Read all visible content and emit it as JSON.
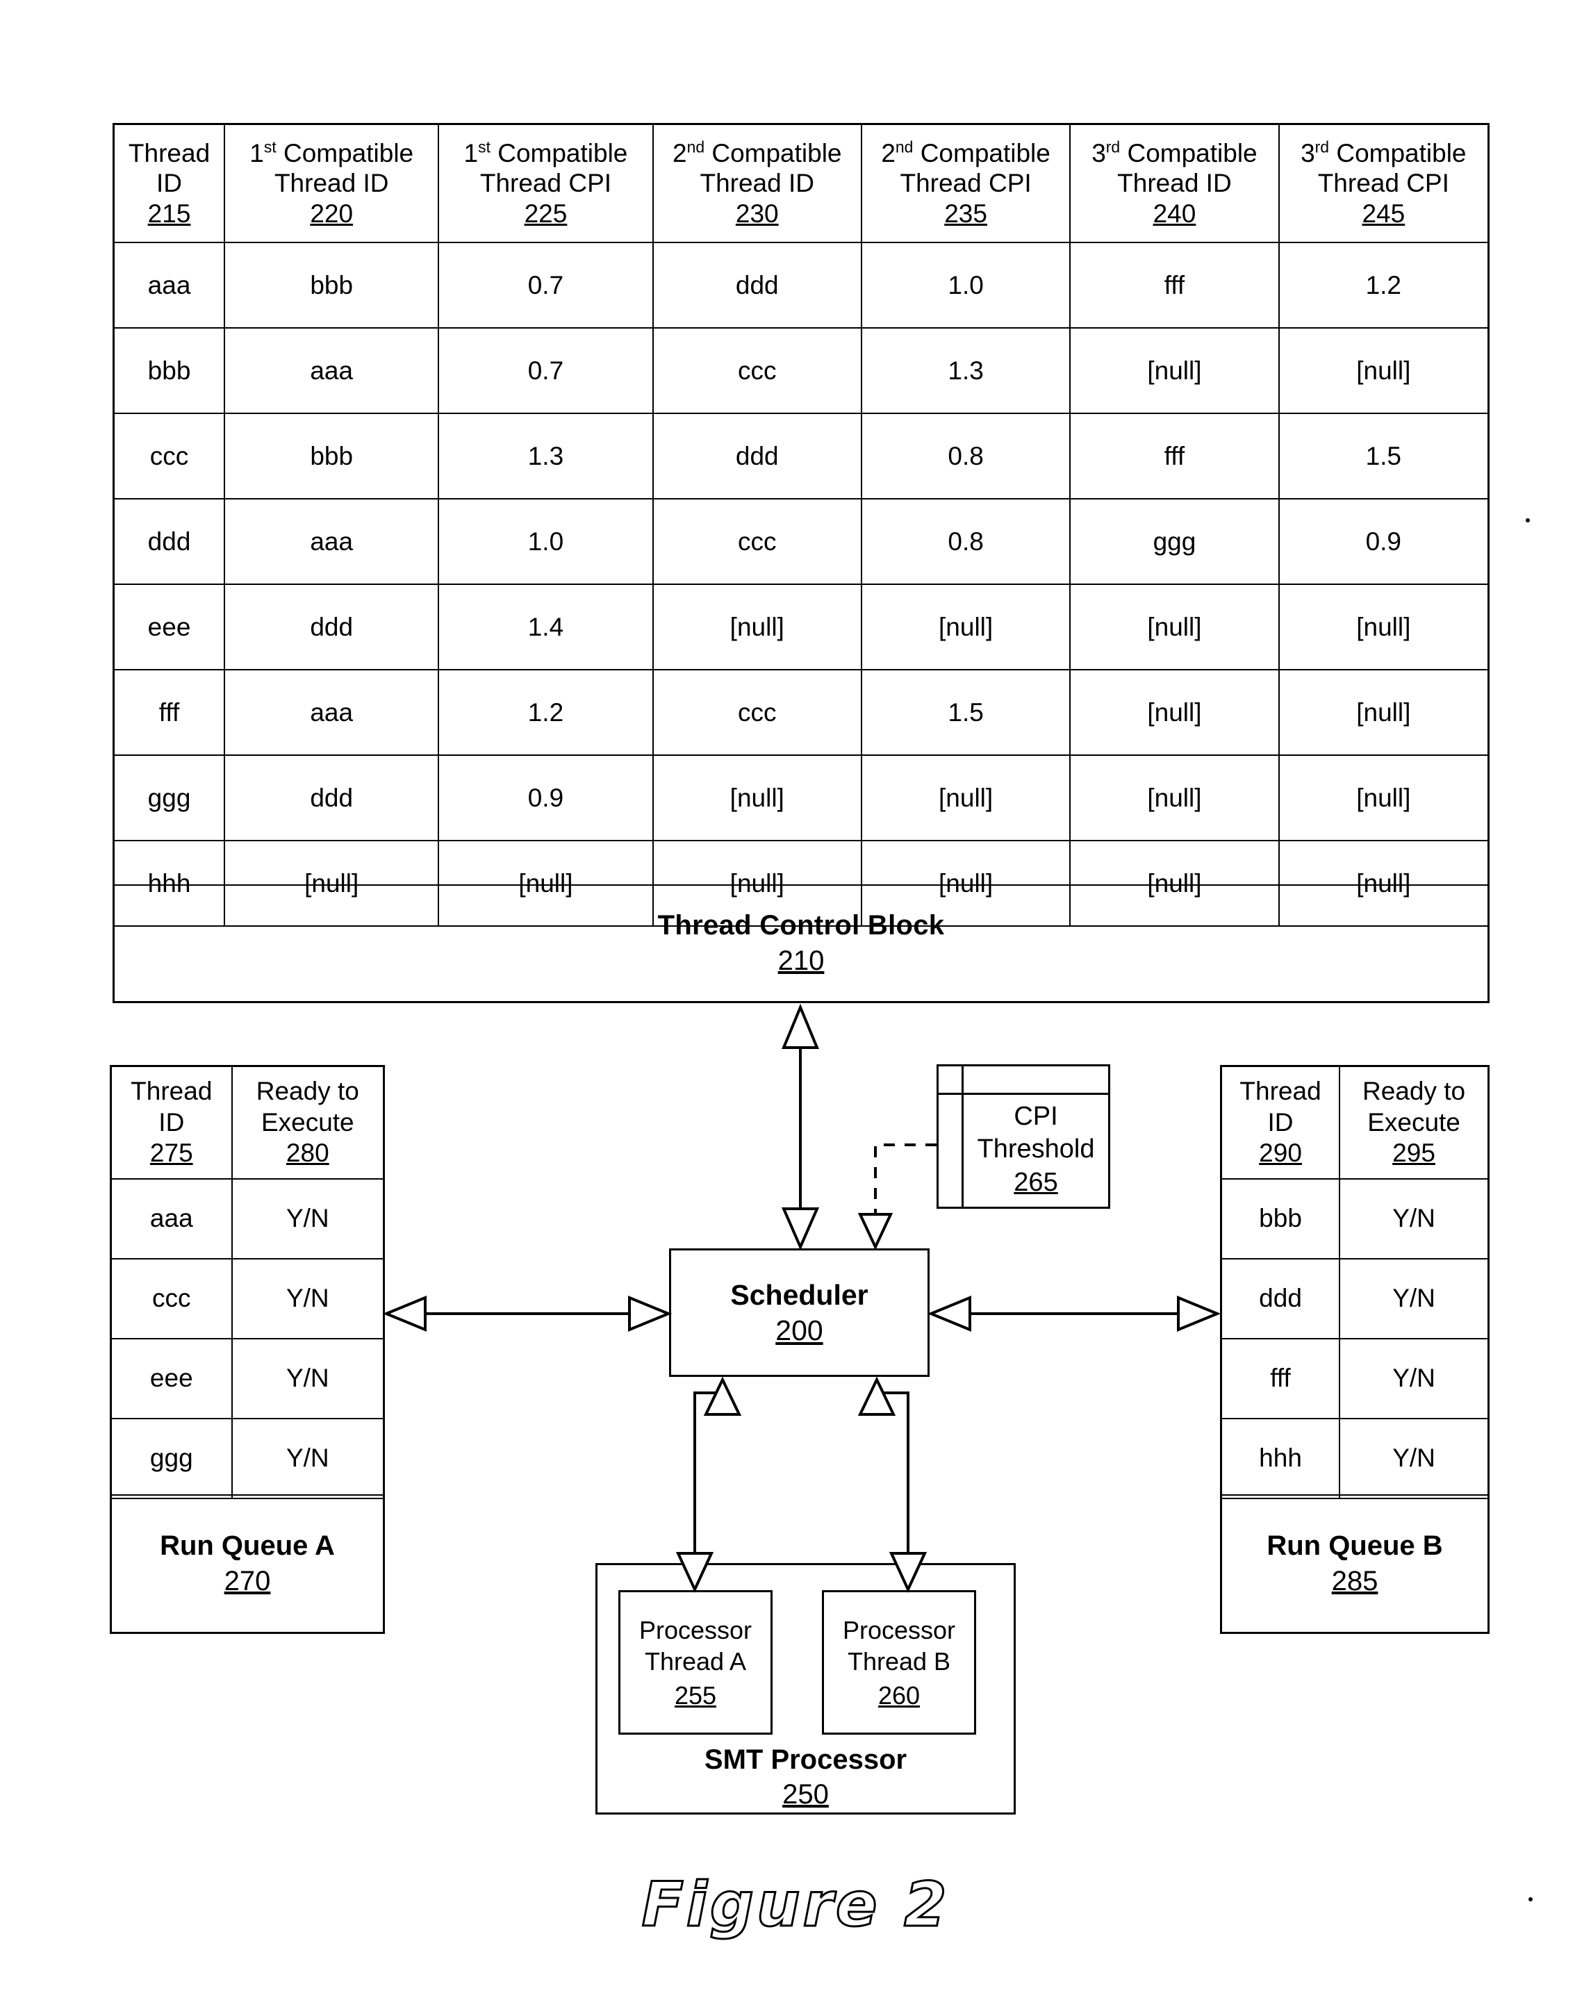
{
  "figure": {
    "caption": "Figure 2"
  },
  "thread_control_block": {
    "title": "Thread Control Block",
    "ref": "210",
    "columns": [
      {
        "line1": "Thread",
        "line2": "ID",
        "ref": "215",
        "sup": ""
      },
      {
        "line1": "1",
        "sup": "st",
        "line1_rest": " Compatible",
        "line2": "Thread ID",
        "ref": "220"
      },
      {
        "line1": "1",
        "sup": "st",
        "line1_rest": " Compatible",
        "line2": "Thread CPI",
        "ref": "225"
      },
      {
        "line1": "2",
        "sup": "nd",
        "line1_rest": " Compatible",
        "line2": "Thread ID",
        "ref": "230"
      },
      {
        "line1": "2",
        "sup": "nd",
        "line1_rest": " Compatible",
        "line2": "Thread CPI",
        "ref": "235"
      },
      {
        "line1": "3",
        "sup": "rd",
        "line1_rest": " Compatible",
        "line2": "Thread ID",
        "ref": "240"
      },
      {
        "line1": "3",
        "sup": "rd",
        "line1_rest": " Compatible",
        "line2": "Thread CPI",
        "ref": "245"
      }
    ],
    "rows": [
      [
        "aaa",
        "bbb",
        "0.7",
        "ddd",
        "1.0",
        "fff",
        "1.2"
      ],
      [
        "bbb",
        "aaa",
        "0.7",
        "ccc",
        "1.3",
        "[null]",
        "[null]"
      ],
      [
        "ccc",
        "bbb",
        "1.3",
        "ddd",
        "0.8",
        "fff",
        "1.5"
      ],
      [
        "ddd",
        "aaa",
        "1.0",
        "ccc",
        "0.8",
        "ggg",
        "0.9"
      ],
      [
        "eee",
        "ddd",
        "1.4",
        "[null]",
        "[null]",
        "[null]",
        "[null]"
      ],
      [
        "fff",
        "aaa",
        "1.2",
        "ccc",
        "1.5",
        "[null]",
        "[null]"
      ],
      [
        "ggg",
        "ddd",
        "0.9",
        "[null]",
        "[null]",
        "[null]",
        "[null]"
      ],
      [
        "hhh",
        "[null]",
        "[null]",
        "[null]",
        "[null]",
        "[null]",
        "[null]"
      ]
    ]
  },
  "run_queue_a": {
    "title": "Run Queue A",
    "ref": "270",
    "columns": [
      {
        "line1": "Thread",
        "line2": "ID",
        "ref": "275"
      },
      {
        "line1": "Ready to",
        "line2": "Execute",
        "ref": "280"
      }
    ],
    "rows": [
      [
        "aaa",
        "Y/N"
      ],
      [
        "ccc",
        "Y/N"
      ],
      [
        "eee",
        "Y/N"
      ],
      [
        "ggg",
        "Y/N"
      ]
    ]
  },
  "run_queue_b": {
    "title": "Run Queue B",
    "ref": "285",
    "columns": [
      {
        "line1": "Thread",
        "line2": "ID",
        "ref": "290"
      },
      {
        "line1": "Ready to",
        "line2": "Execute",
        "ref": "295"
      }
    ],
    "rows": [
      [
        "bbb",
        "Y/N"
      ],
      [
        "ddd",
        "Y/N"
      ],
      [
        "fff",
        "Y/N"
      ],
      [
        "hhh",
        "Y/N"
      ]
    ]
  },
  "cpi_threshold": {
    "line1": "CPI",
    "line2": "Threshold",
    "ref": "265"
  },
  "scheduler": {
    "title": "Scheduler",
    "ref": "200"
  },
  "smt_processor": {
    "title": "SMT Processor",
    "ref": "250",
    "threads": [
      {
        "line1": "Processor",
        "line2": "Thread A",
        "ref": "255"
      },
      {
        "line1": "Processor",
        "line2": "Thread B",
        "ref": "260"
      }
    ]
  }
}
